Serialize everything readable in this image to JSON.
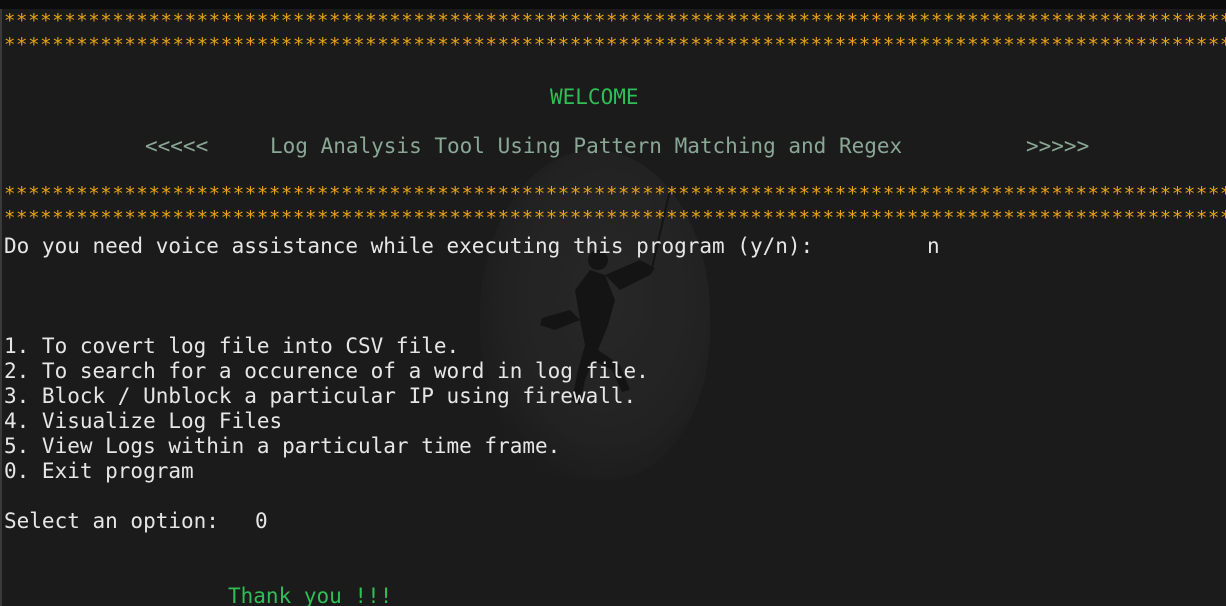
{
  "terminal": {
    "stars_line": "****************************************************************************************************************************",
    "welcome": "WELCOME",
    "banner_left": "<<<<<",
    "banner_title": "Log Analysis Tool Using Pattern Matching and Regex",
    "banner_right": ">>>>>",
    "voice_prompt": "Do you need voice assistance while executing this program (y/n):",
    "voice_answer": "n",
    "menu": [
      "1. To covert log file into CSV file.",
      "2. To search for a occurence of a word in log file.",
      "3. Block / Unblock a particular IP using firewall.",
      "4. Visualize Log Files",
      "5. View Logs within a particular time frame.",
      "0. Exit program"
    ],
    "select_prompt": "Select an option:",
    "select_value": "0",
    "thank_you": "Thank you !!!"
  },
  "colors": {
    "background": "#1b1b1b",
    "stars": "#e8a317",
    "green": "#2fbf56",
    "muted": "#8aa796",
    "text": "#e6e6e6"
  },
  "icons": [
    "climber-watermark-icon"
  ]
}
